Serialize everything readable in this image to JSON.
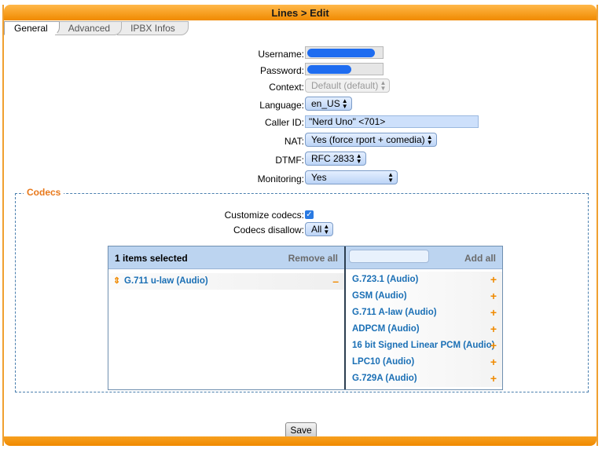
{
  "window": {
    "title": "Lines > Edit"
  },
  "tabs": [
    {
      "label": "General",
      "active": true
    },
    {
      "label": "Advanced",
      "active": false
    },
    {
      "label": "IPBX Infos",
      "active": false
    }
  ],
  "form": {
    "username": {
      "label": "Username:",
      "value": ""
    },
    "password": {
      "label": "Password:",
      "value": ""
    },
    "context": {
      "label": "Context:",
      "value": "Default (default)",
      "disabled": true
    },
    "language": {
      "label": "Language:",
      "value": "en_US"
    },
    "caller_id": {
      "label": "Caller ID:",
      "value": "\"Nerd Uno\" <701>"
    },
    "nat": {
      "label": "NAT:",
      "value": "Yes (force rport + comedia)"
    },
    "dtmf": {
      "label": "DTMF:",
      "value": "RFC 2833"
    },
    "monitoring": {
      "label": "Monitoring:",
      "value": "Yes"
    }
  },
  "codecs": {
    "legend": "Codecs",
    "customize": {
      "label": "Customize codecs:",
      "checked": true
    },
    "disallow": {
      "label": "Codecs disallow:",
      "value": "All"
    },
    "selected": {
      "header": "1 items selected",
      "remove_all": "Remove all",
      "items": [
        "G.711 u-law (Audio)"
      ]
    },
    "available": {
      "search_placeholder": "",
      "add_all": "Add all",
      "items": [
        "G.723.1 (Audio)",
        "GSM (Audio)",
        "G.711 A-law (Audio)",
        "ADPCM (Audio)",
        "16 bit Signed Linear PCM (Audio)",
        "LPC10 (Audio)",
        "G.729A (Audio)"
      ]
    }
  },
  "actions": {
    "save": "Save"
  },
  "colors": {
    "accent": "#f08a00",
    "link": "#1a6fb5",
    "legend": "#e8781a"
  }
}
